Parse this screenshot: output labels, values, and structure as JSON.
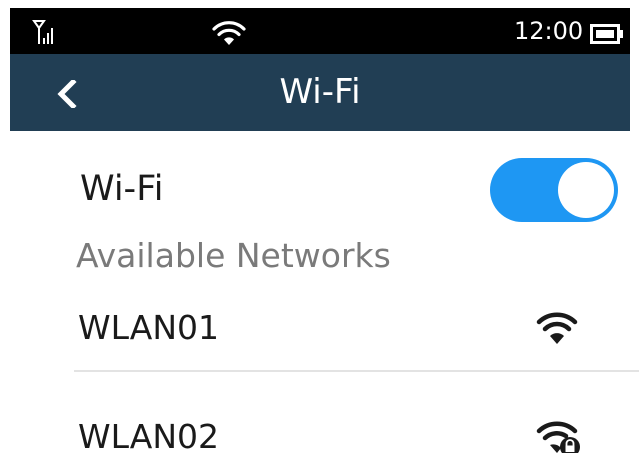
{
  "status_bar": {
    "time": "12:00",
    "icons": [
      "signal-icon",
      "wifi-status-icon",
      "battery-icon"
    ]
  },
  "nav": {
    "title": "Wi-Fi",
    "back_icon": "chevron-left-icon"
  },
  "wifi_toggle": {
    "label": "Wi-Fi",
    "state": "on",
    "color": "#1e97f3"
  },
  "available_networks": {
    "header": "Available Networks",
    "items": [
      {
        "name": "WLAN01",
        "secured": false,
        "icon": "wifi-signal-icon"
      },
      {
        "name": "WLAN02",
        "secured": true,
        "icon": "wifi-locked-icon"
      }
    ]
  },
  "colors": {
    "nav_bar": "#213e54",
    "status_bar": "#000000",
    "accent": "#1e97f3"
  }
}
